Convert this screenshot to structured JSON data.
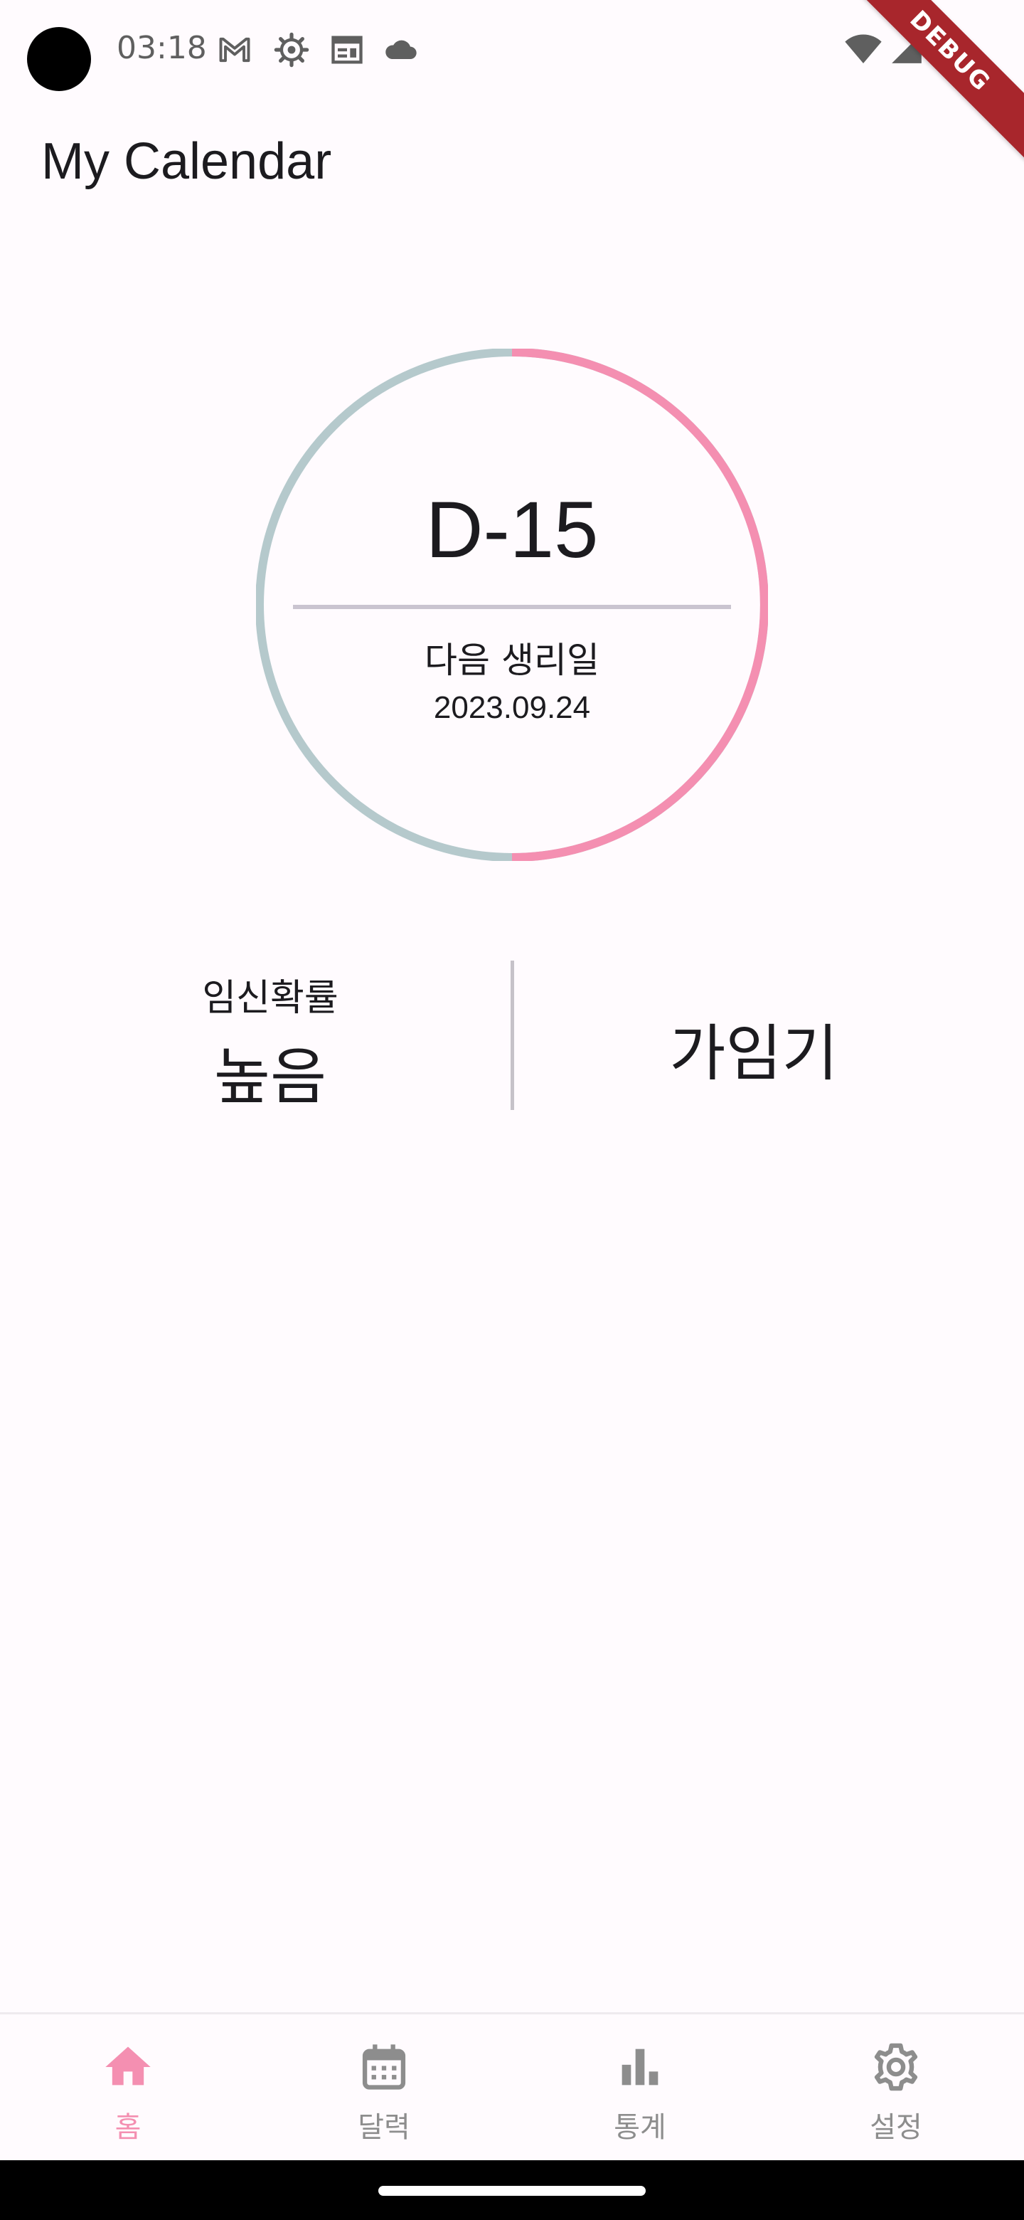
{
  "status_bar": {
    "time": "03:18",
    "left_icons": [
      "gmail-icon",
      "settings-gear-icon",
      "calendar-app-icon",
      "cloud-icon"
    ],
    "right_icons": [
      "wifi-icon",
      "cellular-signal-icon",
      "battery-icon"
    ]
  },
  "debug_banner": "DEBUG",
  "app_bar": {
    "title": "My Calendar"
  },
  "cycle_ring": {
    "dday": "D-15",
    "next_period_label": "다음 생리일",
    "next_period_date": "2023.09.24",
    "progress_fraction": 0.5,
    "colors": {
      "progress": "#f48fb1",
      "track": "#b5c9cc"
    }
  },
  "fertility": {
    "probability_label": "임신확률",
    "probability_value": "높음",
    "phase": "가임기"
  },
  "bottom_nav": {
    "active_color": "#f48fb1",
    "inactive_color": "#8d8d8d",
    "items": [
      {
        "label": "홈",
        "icon": "home-icon",
        "active": true
      },
      {
        "label": "달력",
        "icon": "calendar-icon",
        "active": false
      },
      {
        "label": "통계",
        "icon": "bar-chart-icon",
        "active": false
      },
      {
        "label": "설정",
        "icon": "settings-icon",
        "active": false
      }
    ]
  }
}
